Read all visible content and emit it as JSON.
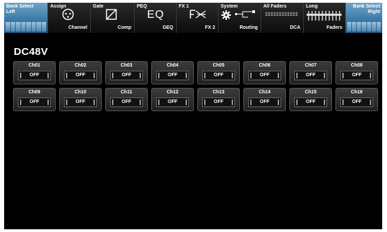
{
  "topbar": {
    "bank_left": {
      "label": "Bank Select Left"
    },
    "assign": {
      "label": "Assign",
      "sub": "Channel"
    },
    "gate": {
      "label": "Gate",
      "sub": "Comp"
    },
    "peq": {
      "label": "PEQ",
      "main": "EQ",
      "sub": "GEQ"
    },
    "fx": {
      "label": "FX 1",
      "sub": "FX 2"
    },
    "system": {
      "label": "System",
      "sub": "Routing"
    },
    "all_faders": {
      "label": "All Faders",
      "sub": "DCA"
    },
    "long": {
      "label": "Long",
      "sub": "Faders"
    },
    "bank_right": {
      "label": "Bank Select Right"
    }
  },
  "page": {
    "title": "DC48V"
  },
  "channels": [
    {
      "name": "Ch01",
      "state": "OFF"
    },
    {
      "name": "Ch02",
      "state": "OFF"
    },
    {
      "name": "Ch03",
      "state": "OFF"
    },
    {
      "name": "Ch04",
      "state": "OFF"
    },
    {
      "name": "Ch05",
      "state": "OFF"
    },
    {
      "name": "Ch06",
      "state": "OFF"
    },
    {
      "name": "Ch07",
      "state": "OFF"
    },
    {
      "name": "Ch08",
      "state": "OFF"
    },
    {
      "name": "Ch09",
      "state": "OFF"
    },
    {
      "name": "Ch10",
      "state": "OFF"
    },
    {
      "name": "Ch11",
      "state": "OFF"
    },
    {
      "name": "Ch12",
      "state": "OFF"
    },
    {
      "name": "Ch13",
      "state": "OFF"
    },
    {
      "name": "Ch14",
      "state": "OFF"
    },
    {
      "name": "Ch15",
      "state": "OFF"
    },
    {
      "name": "Ch16",
      "state": "OFF"
    }
  ]
}
